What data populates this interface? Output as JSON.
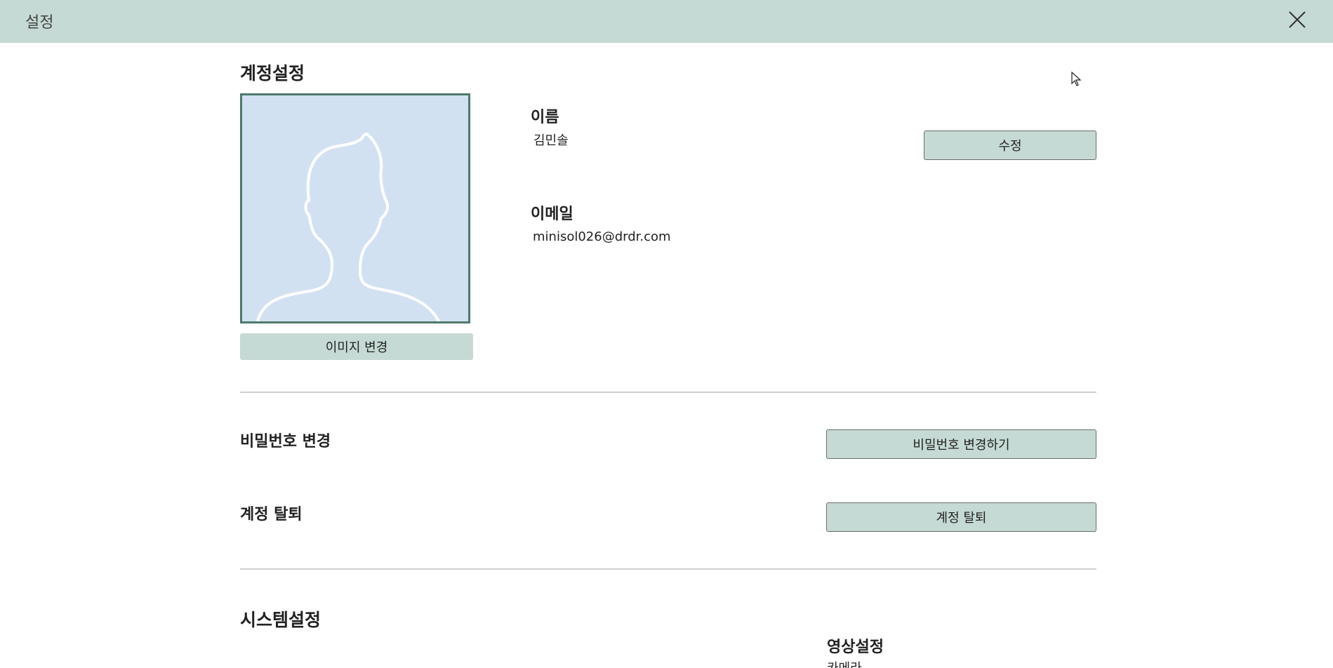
{
  "window": {
    "title": "설정",
    "close_icon": "close-icon"
  },
  "account": {
    "heading": "계정설정",
    "avatar_icon": "person-silhouette-icon",
    "change_image_label": "이미지 변경",
    "name_label": "이름",
    "name_value": "김민솔",
    "edit_label": "수정",
    "email_label": "이메일",
    "email_value": "minisol026@drdr.com"
  },
  "password": {
    "label": "비밀번호 변경",
    "button_label": "비밀번호 변경하기"
  },
  "withdraw": {
    "label": "계정 탈퇴",
    "button_label": "계정 탈퇴"
  },
  "system": {
    "heading": "시스템설정",
    "video_label": "영상설정",
    "video_sub_partial": "카메라"
  },
  "colors": {
    "titlebar": "#c5dad4",
    "button": "#c5dad4",
    "avatar_bg": "#d2e1f2",
    "avatar_border": "#4c7a6c"
  }
}
